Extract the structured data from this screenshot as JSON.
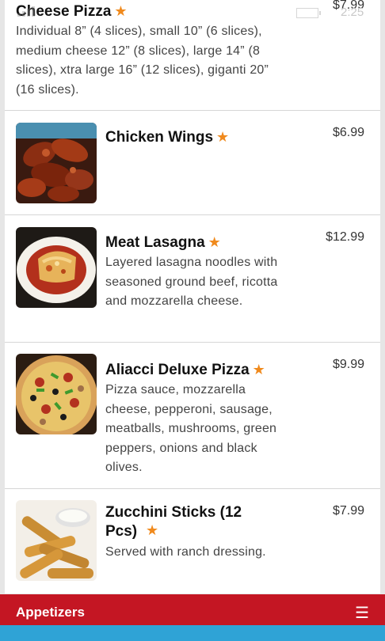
{
  "status": {
    "time": "2:25"
  },
  "items": [
    {
      "name": "Cheese Pizza",
      "price": "$7.99",
      "description": "Individual 8” (4 slices), small 10” (6 slices), medium cheese 12” (8 slices), large 14” (8 slices), xtra large 16” (12 slices), giganti 20” (16 slices)."
    },
    {
      "name": "Chicken Wings",
      "price": "$6.99",
      "description": ""
    },
    {
      "name": "Meat Lasagna",
      "price": "$12.99",
      "description": "Layered lasagna noodles with seasoned ground beef, ricotta and mozzarella cheese."
    },
    {
      "name": "Aliacci Deluxe Pizza",
      "price": "$9.99",
      "description": "Pizza sauce, mozzarella cheese, pepperoni, sausage, meatballs, mushrooms, green peppers, onions and black olives."
    },
    {
      "name": "Zucchini Sticks (12 Pcs)",
      "price": "$7.99",
      "description": "Served with ranch dressing."
    }
  ],
  "star_glyph": "★",
  "bottom_bar": {
    "category": "Appetizers",
    "menu_glyph": "☰"
  },
  "colors": {
    "accent_bar": "#c41623",
    "star": "#f08a1d",
    "nav_strip": "#2fa3d6"
  }
}
